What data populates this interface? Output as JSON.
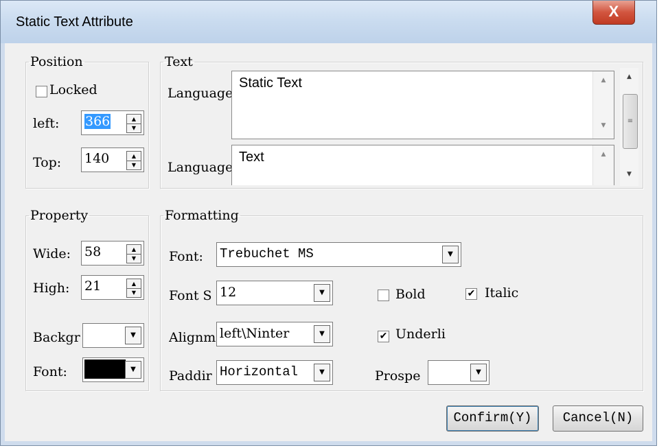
{
  "window": {
    "title": "Static Text Attribute",
    "close_glyph": "X"
  },
  "position": {
    "legend": "Position",
    "locked_label": "Locked",
    "locked_checked": false,
    "left_label": "left:",
    "left_value": "366",
    "top_label": "Top:",
    "top_value": "140"
  },
  "text": {
    "legend": "Text",
    "lang1_label": "Language",
    "lang1_value": "Static Text",
    "lang2_label": "Language",
    "lang2_value": "Text"
  },
  "property": {
    "legend": "Property",
    "wide_label": "Wide:",
    "wide_value": "58",
    "high_label": "High:",
    "high_value": "21",
    "background_label": "Backgr",
    "font_label": "Font:",
    "font_color": "#000000",
    "background_color": "#ffffff"
  },
  "formatting": {
    "legend": "Formatting",
    "font_label": "Font:",
    "font_value": "Trebuchet MS",
    "font_size_label": "Font S",
    "font_size_value": "12",
    "align_label": "Alignm",
    "align_value": "left\\Ninter",
    "padding_label": "Paddir",
    "padding_value": "Horizontal",
    "bold_label": "Bold",
    "bold_checked": false,
    "italic_label": "Italic",
    "italic_checked": true,
    "underline_label": "Underli",
    "underline_checked": true,
    "prospect_label": "Prospe",
    "prospect_value": ""
  },
  "buttons": {
    "confirm": "Confirm(Y)",
    "cancel": "Cancel(N)"
  },
  "glyphs": {
    "check": "✔",
    "up": "▲",
    "down": "▼"
  }
}
